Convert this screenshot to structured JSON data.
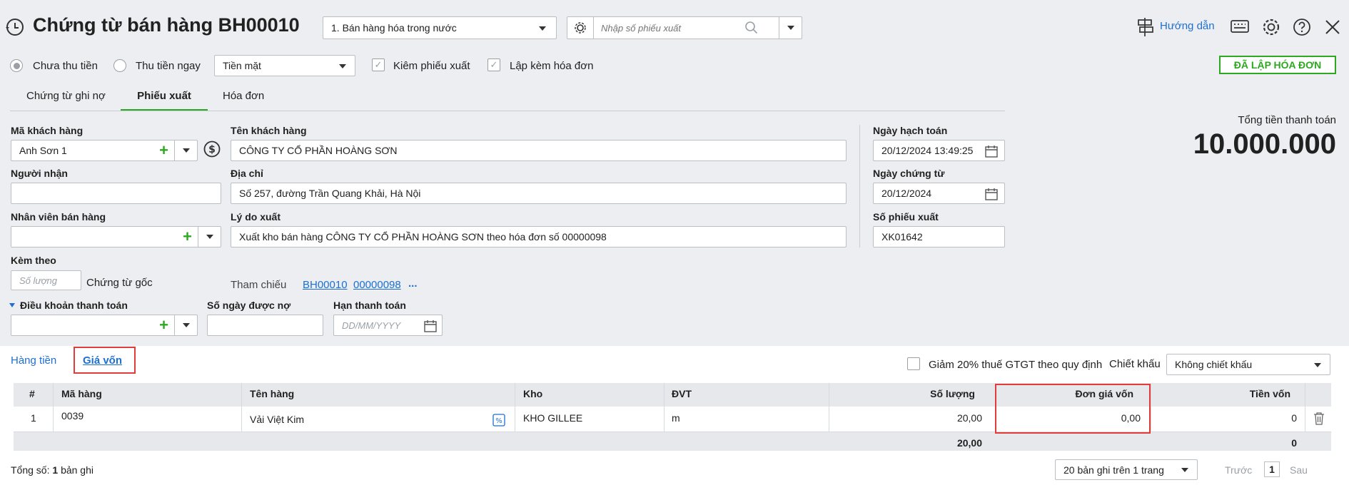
{
  "header": {
    "title": "Chứng từ bán hàng BH00010",
    "type_select": "1. Bán hàng hóa trong nước",
    "search_placeholder": "Nhập số phiếu xuất",
    "help_label": "Hướng dẫn"
  },
  "options": {
    "radio_unpaid": "Chưa thu tiền",
    "radio_paid": "Thu tiền ngay",
    "payment_method": "Tiền mặt",
    "check_export": "Kiêm phiếu xuất",
    "check_invoice": "Lập kèm hóa đơn",
    "invoiced_badge": "ĐÃ LẬP HÓA ĐƠN"
  },
  "tabs": [
    {
      "label": "Chứng từ ghi nợ"
    },
    {
      "label": "Phiếu xuất"
    },
    {
      "label": "Hóa đơn"
    }
  ],
  "form": {
    "customer_code_label": "Mã khách hàng",
    "customer_code": "Anh Sơn 1",
    "customer_name_label": "Tên khách hàng",
    "customer_name": "CÔNG TY CỔ PHẦN HOÀNG SƠN",
    "receiver_label": "Người nhận",
    "receiver": "",
    "address_label": "Địa chỉ",
    "address": "Số 257, đường Trần Quang Khải, Hà Nội",
    "salesperson_label": "Nhân viên bán hàng",
    "salesperson": "",
    "reason_label": "Lý do xuất",
    "reason": "Xuất kho bán hàng CÔNG TY CỔ PHẦN HOÀNG SƠN theo hóa đơn số 00000098",
    "attach_label": "Kèm theo",
    "attach_placeholder": "Số lượng",
    "attach_suffix": "Chứng từ gốc",
    "ref_label": "Tham chiếu",
    "ref_1": "BH00010",
    "ref_2": "00000098",
    "ref_more": "...",
    "payment_terms_label": "Điều khoản thanh toán",
    "credit_days_label": "Số ngày được nợ",
    "due_date_label": "Hạn thanh toán",
    "due_date_placeholder": "DD/MM/YYYY",
    "posting_date_label": "Ngày hạch toán",
    "posting_date": "20/12/2024 13:49:25",
    "voucher_date_label": "Ngày chứng từ",
    "voucher_date": "20/12/2024",
    "export_no_label": "Số phiếu xuất",
    "export_no": "XK01642"
  },
  "total": {
    "label": "Tổng tiền thanh toán",
    "value": "10.000.000"
  },
  "subtabs": {
    "money": "Hàng tiền",
    "cost": "Giá vốn"
  },
  "discount": {
    "vat_reduction": "Giảm 20% thuế GTGT theo quy định",
    "label": "Chiết khấu",
    "value": "Không chiết khấu"
  },
  "table": {
    "headers": {
      "num": "#",
      "code": "Mã hàng",
      "name": "Tên hàng",
      "warehouse": "Kho",
      "unit": "ĐVT",
      "qty": "Số lượng",
      "unit_cost": "Đơn giá vốn",
      "cost": "Tiền vốn"
    },
    "rows": [
      {
        "num": "1",
        "code": "0039",
        "name": "Vải Việt Kim",
        "warehouse": "KHO GILLEE",
        "unit": "m",
        "qty": "20,00",
        "unit_cost": "0,00",
        "cost": "0"
      }
    ],
    "totals": {
      "qty": "20,00",
      "cost": "0"
    }
  },
  "footer": {
    "total_prefix": "Tổng số:",
    "total_count": "1",
    "total_suffix": "bản ghi",
    "page_size": "20 bản ghi trên 1 trang",
    "prev": "Trước",
    "page": "1",
    "next": "Sau"
  },
  "colors": {
    "accent": "#1d6fd1",
    "green": "#2ea820",
    "highlight": "#e03c3c"
  }
}
